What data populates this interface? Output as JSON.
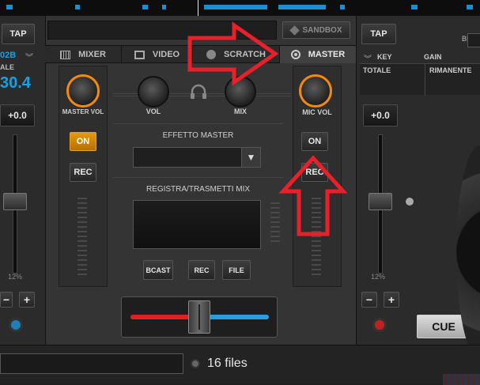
{
  "top": {
    "sandbox_label": "SANDBOX"
  },
  "tabs": [
    {
      "label": "MIXER",
      "icon": "mixer-icon"
    },
    {
      "label": "VIDEO",
      "icon": "film-icon"
    },
    {
      "label": "SCRATCH",
      "icon": "vinyl-icon"
    },
    {
      "label": "MASTER",
      "icon": "target-icon",
      "active": true
    }
  ],
  "deck_left": {
    "tap_label": "TAP",
    "key_value": "02B",
    "scale_label": "ALE",
    "bpm_value": "30.4",
    "pitch_value": "+0.0",
    "pitch_range": "12%",
    "minus_label": "−",
    "plus_label": "+"
  },
  "deck_right": {
    "tap_label": "TAP",
    "bpm_label": "BPM",
    "key_label": "KEY",
    "gain_label": "GAIN",
    "totale_label": "TOTALE",
    "rimanente_label": "RIMANENTE",
    "pitch_value": "+0.0",
    "pitch_range": "12%",
    "minus_label": "−",
    "plus_label": "+",
    "cue_label": "CUE"
  },
  "mixer": {
    "master_vol_label": "MASTER VOL",
    "vol_label": "VOL",
    "mix_label": "MIX",
    "mic_vol_label": "MIC VOL",
    "master_on_label": "ON",
    "master_rec_label": "REC",
    "mic_on_label": "ON",
    "mic_rec_label": "REC",
    "effetto_master_label": "EFFETTO MASTER",
    "registra_label": "REGISTRA/TRASMETTI MIX",
    "bcast_label": "BCAST",
    "rec_label": "REC",
    "file_label": "FILE"
  },
  "browser": {
    "files_count_text": "16 files"
  },
  "colors": {
    "accent_orange": "#f08a12",
    "annotation_red": "#e8202a",
    "wave_blue": "#1a8fd0",
    "crossfader_left": "#e02020",
    "crossfader_right": "#2a9de0"
  }
}
